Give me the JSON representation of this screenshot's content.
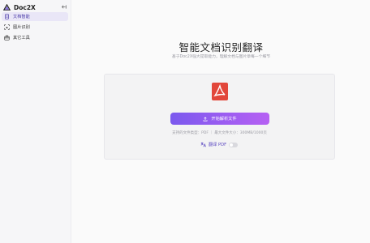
{
  "app": {
    "name": "Doc2X"
  },
  "sidebar": {
    "items": [
      {
        "label": "文档智能",
        "icon": "document-icon",
        "active": true
      },
      {
        "label": "图片识别",
        "icon": "image-scan-icon",
        "active": false
      },
      {
        "label": "其它工具",
        "icon": "toolbox-icon",
        "active": false
      }
    ]
  },
  "main": {
    "title": "智能文档识别翻译",
    "subtitle": "基于Doc2X强大提取能力，理解文档与图片章每一个细节",
    "upload": {
      "button_label": "开始解析文件",
      "support_text": "支持的文件类型：PDF ｜ 最大文件大小：300MB/1000页",
      "translate_label": "翻译 PDF",
      "translate_enabled": false
    }
  },
  "colors": {
    "accent_start": "#7b59ee",
    "accent_end": "#b660f3",
    "pdf_red": "#e2473b",
    "active_nav_bg": "#e9e6f7"
  }
}
